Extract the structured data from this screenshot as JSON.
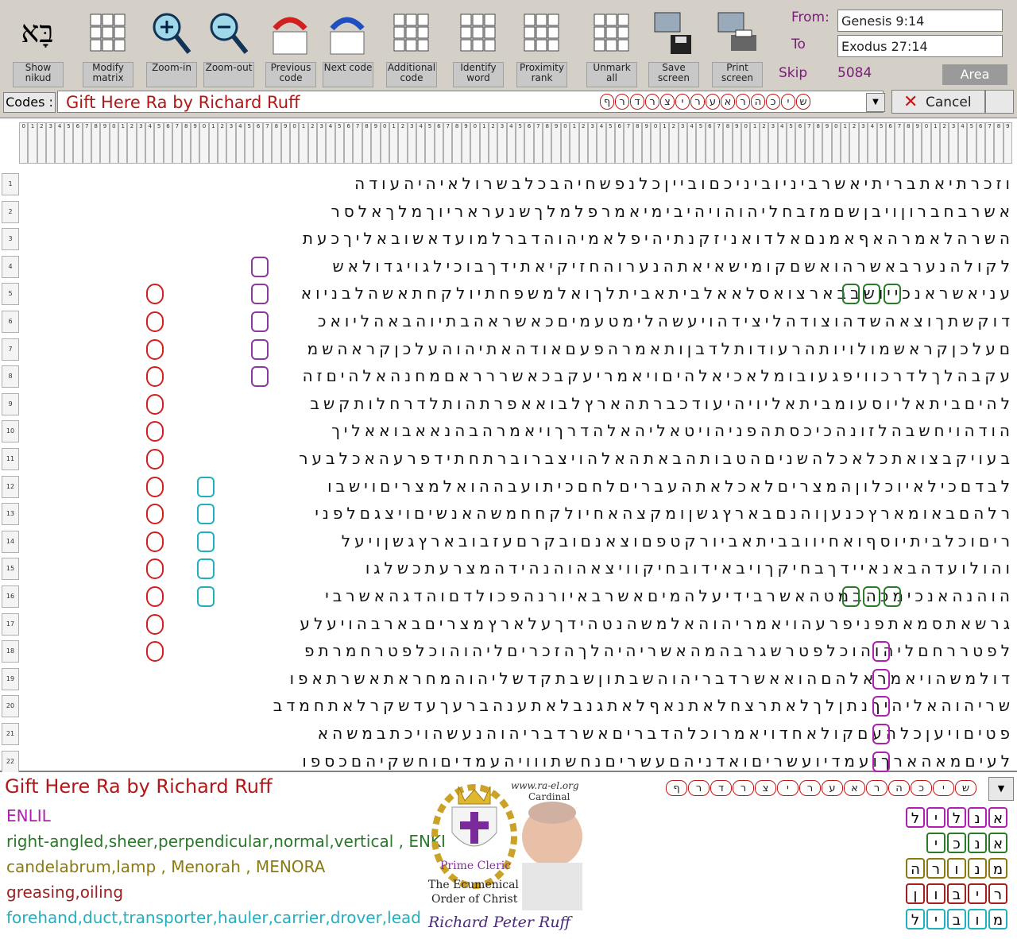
{
  "toolbar": {
    "buttons": [
      {
        "label": "Show nikud"
      },
      {
        "label": "Modify matrix"
      },
      {
        "label": "Zoom-in"
      },
      {
        "label": "Zoom-out"
      },
      {
        "label": "Previous code"
      },
      {
        "label": "Next code"
      },
      {
        "label": "Additional code"
      },
      {
        "label": "Identify word"
      },
      {
        "label": "Proximity rank"
      },
      {
        "label": "Unmark all"
      },
      {
        "label": "Save screen"
      },
      {
        "label": "Print screen"
      }
    ],
    "from_label": "From:",
    "from_value": "Genesis 9:14",
    "to_label": "To",
    "to_value": "Exodus 27:14",
    "skip_label": "Skip",
    "skip_value": "5084",
    "area_label": "Area"
  },
  "codes": {
    "label": "Codes :",
    "value": "Gift Here Ra by Richard Ruff",
    "letters": [
      "ש",
      "י",
      "כ",
      "ה",
      "ר",
      "א",
      "ע",
      "ר",
      "י",
      "צ",
      "ר",
      "ד",
      "ר",
      "ף"
    ],
    "cancel_label": "Cancel"
  },
  "matrix": {
    "col_numbers": [
      "0",
      "1",
      "2",
      "3",
      "4",
      "5",
      "6",
      "7",
      "8",
      "9",
      "0",
      "1",
      "2",
      "3",
      "4",
      "5",
      "6",
      "7",
      "8",
      "9",
      "0",
      "1",
      "2",
      "3",
      "4",
      "5",
      "6",
      "7",
      "8",
      "9",
      "0",
      "1",
      "2",
      "3",
      "4",
      "5",
      "6",
      "7",
      "8",
      "9",
      "0",
      "1",
      "2",
      "3",
      "4",
      "5",
      "6",
      "7",
      "8",
      "9",
      "0",
      "1",
      "2",
      "3",
      "4",
      "5",
      "6",
      "7",
      "8",
      "9",
      "0",
      "1",
      "2",
      "3",
      "4",
      "5",
      "6",
      "7",
      "8",
      "9",
      "0",
      "1",
      "2",
      "3",
      "4",
      "5",
      "6",
      "7",
      "8",
      "9",
      "0",
      "1",
      "2",
      "3",
      "4",
      "5",
      "6",
      "7",
      "8",
      "9",
      "0",
      "1",
      "2",
      "3",
      "4",
      "5",
      "6",
      "7",
      "8",
      "9",
      "0",
      "1",
      "2",
      "3",
      "4",
      "5",
      "6",
      "7",
      "8",
      "9"
    ],
    "rows": [
      {
        "n": "1",
        "text": "וזכרתיאתבריתיאשרביניוביניכםובייןכלנפשחיהבכלבשרולאיהיהעודה"
      },
      {
        "n": "2",
        "text": "אשרבחברוןויבןשםמזבחליהוהויהיבימיאמרפלמלךשנעראריוךמלךאלסר"
      },
      {
        "n": "3",
        "text": "השרהלאמרהאףאמנםאלדואניזקנתיהיפלאמיהוהדברלמועדאשובאליךכעת"
      },
      {
        "n": "4",
        "text": "לקולהנערבאשרהואשםקומישאיאתהנערוהחזיקיאתידךבוכילגויגדולאש"
      },
      {
        "n": "5",
        "text": "עניאשראנכייושבבארצואסלאאלביתאביתלךואלמשפחתיולקחתאשהלבניוא"
      },
      {
        "n": "6",
        "text": "דוקשתךוצאהשדהוצודהליצידהויעשהלימטעמיםכאשראהבתיוהבאהליואכ"
      },
      {
        "n": "7",
        "text": "םעלכןקראשמולויותהרעודותלדבןותאמרהפעםאודהאתיהוהעלכןקראהשמ"
      },
      {
        "n": "8",
        "text": "עקבהלךלדרכוויפגעובומלאכיאלהיםויאמריעקבכאשררראםמחנהאלהיםזה"
      },
      {
        "n": "9",
        "text": "להיםביתאליוסעומביתאליויהיעודכברתהארץלבואאפרתהותלדרחלותקשב"
      },
      {
        "n": "10",
        "text": "הודהויחשבהלזונהכיכסתהפניהויטאליהאלהדרךויאמרהבהנאאבואאליך"
      },
      {
        "n": "11",
        "text": "בעויקבצואתכלאכלהשניםהטבותהבאתהאלהויצברוברתחתידפרעהאכלבער"
      },
      {
        "n": "12",
        "text": "לבדםכילאיוכלוןהמצריםלאכלאתהעבריםלחםכיתועבההואלמצריםוישבו"
      },
      {
        "n": "13",
        "text": "רלהםבאומארץכנעןוהנםבארץגשןומקצהאחיולקחחמשהאנשיםויצגםלפני"
      },
      {
        "n": "14",
        "text": "ריםוכלביתיוסףואחיוובביתאביורקטפםוצאנםובקרםעזבובארץגשןויעל"
      },
      {
        "n": "15",
        "text": "והולועדהבאנאיידךבחיקךויבאידובחיקוויצאהוהנהידהמצרעתכשלגו"
      },
      {
        "n": "16",
        "text": "הוהנהאנכימכהבמטהאשרבידיעלהמיםאשרבאיורנהפכולדםוהדגהאשרבי"
      },
      {
        "n": "17",
        "text": "גרשאתסמאתפניפרעהויאמריהוהאלמשהנטהידךעלארץמצריםבארבהויעלע"
      },
      {
        "n": "18",
        "text": "לפטררחםליהוהוכלפטרשגרבהמהאשריהיהלךהזכריםליהוהוכלפטרחמרתפ"
      },
      {
        "n": "19",
        "text": "דולמשהויאמראלהםהואאשרדבריהוהשבתוןשבתקדשליהוהמחראתאשרתאפו"
      },
      {
        "n": "20",
        "text": "שריהוהאליהיךנתןלךלאתרצחלאתנאףלאתגנבלאתענהברעךעדשקרלאתחמדב"
      },
      {
        "n": "21",
        "text": "פטיםויעןכלהעםקולאחדויאמרוכלהדבריםאשרדבריהוהנעשהויכתבמשהא"
      },
      {
        "n": "22",
        "text": "לעיםמאהארךועמדיועשריםואדניהםעשריםנחשתווויהעמדיםוחשקיהםכספו"
      }
    ]
  },
  "bottom": {
    "title": "Gift Here Ra by Richard Ruff",
    "meanings": [
      {
        "text": "ENLIL",
        "color": "#b020b0"
      },
      {
        "text": "right-angled,sheer,perpendicular,normal,vertical , ENKI",
        "color": "#2a7a2a"
      },
      {
        "text": "candelabrum,lamp , Menorah , MENORA",
        "color": "#8a7a10"
      },
      {
        "text": "greasing,oiling",
        "color": "#a02020"
      },
      {
        "text": "forehand,duct,transporter,hauler,carrier,drover,lead",
        "color": "#20b0c0"
      }
    ],
    "emblem": {
      "site": "www.ra-el.org",
      "cardinal": "Cardinal",
      "prime": "Prime Cleric",
      "order1": "The Ecumenical",
      "order2": "Order of Christ",
      "signature": "Richard Peter Ruff"
    },
    "words": [
      {
        "letters": [
          "א",
          "נ",
          "ל",
          "י",
          "ל"
        ],
        "color": "#b020b0"
      },
      {
        "letters": [
          "א",
          "נ",
          "כ",
          "י"
        ],
        "color": "#2a7a2a"
      },
      {
        "letters": [
          "מ",
          "נ",
          "ו",
          "ר",
          "ה"
        ],
        "color": "#8a7a10"
      },
      {
        "letters": [
          "ר",
          "י",
          "ב",
          "ו",
          "ן"
        ],
        "color": "#a02020"
      },
      {
        "letters": [
          "מ",
          "ו",
          "ב",
          "י",
          "ל"
        ],
        "color": "#20b0c0"
      }
    ]
  }
}
